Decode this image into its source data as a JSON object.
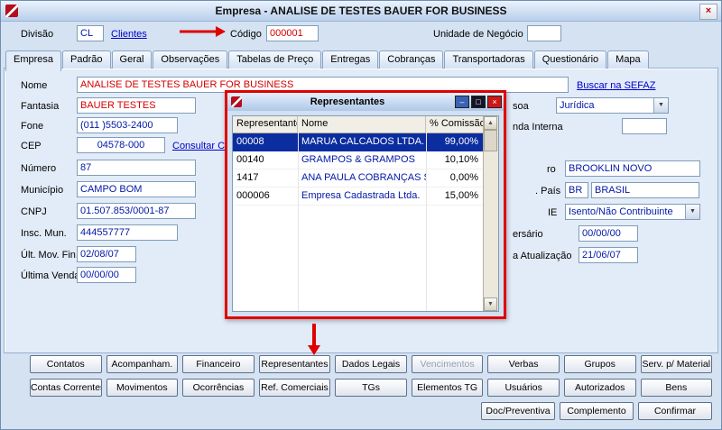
{
  "window": {
    "title": "Empresa - ANALISE DE TESTES BAUER FOR BUSINESS"
  },
  "glyphs": {
    "close": "×",
    "min": "–",
    "max": "□",
    "scroll_up": "▲",
    "scroll_down": "▼",
    "dropdown": "▼"
  },
  "header": {
    "divisao_label": "Divisão",
    "divisao_value": "CL",
    "clientes_link": "Clientes",
    "codigo_label": "Código",
    "codigo_value": "000001",
    "unidade_label": "Unidade de Negócio",
    "unidade_value": ""
  },
  "tabs": {
    "items": [
      "Empresa",
      "Padrão",
      "Geral",
      "Observações",
      "Tabelas de Preço",
      "Entregas",
      "Cobranças",
      "Transportadoras",
      "Questionário",
      "Mapa"
    ]
  },
  "form": {
    "nome_label": "Nome",
    "nome_value": "ANALISE DE TESTES BAUER FOR BUSINESS",
    "sefaz_link": "Buscar na SEFAZ",
    "fantasia_label": "Fantasia",
    "fantasia_value": "BAUER TESTES",
    "fone_label": "Fone",
    "fone_value": "(011 )5503-2400",
    "cep_label": "CEP",
    "cep_value": "04578-000",
    "cep_link": "Consultar CEP",
    "numero_label": "Número",
    "numero_value": "87",
    "municipio_label": "Município",
    "municipio_value": "CAMPO BOM",
    "cnpj_label": "CNPJ",
    "cnpj_value": "01.507.853/0001-87",
    "insc_label": "Insc. Mun.",
    "insc_value": "444557777",
    "ult_mov_label": "Últ. Mov. Fin.",
    "ult_mov_value": "02/08/07",
    "ultima_venda_label": "Última Venda",
    "ultima_venda_value": "00/00/00"
  },
  "right": {
    "pessoa_label": "soa",
    "pessoa_value": "Jurídica",
    "venda_interna_label": "nda Interna",
    "venda_interna_value": "",
    "bairro_label": "ro",
    "bairro_value": "BROOKLIN NOVO",
    "pais_label": ". País",
    "pais_code": "BR",
    "pais_value": "BRASIL",
    "ie_label": "IE",
    "ie_value": "Isento/Não Contribuinte",
    "aniversario_label": "ersário",
    "aniversario_value": "00/00/00",
    "atualizacao_label": "a Atualização",
    "atualizacao_value": "21/06/07"
  },
  "popup": {
    "title": "Representantes",
    "columns": [
      "Representante",
      "Nome",
      "% Comissão"
    ],
    "rows": [
      {
        "code": "00008",
        "name": "MARUA CALCADOS LTDA.",
        "commission": "99,00%"
      },
      {
        "code": "00140",
        "name": "GRAMPOS & GRAMPOS",
        "commission": "10,10%"
      },
      {
        "code": "1417",
        "name": "ANA PAULA COBRANÇAS S.A.-",
        "commission": "0,00%"
      },
      {
        "code": "000006",
        "name": "Empresa Cadastrada Ltda.",
        "commission": "15,00%"
      }
    ]
  },
  "buttons": {
    "row1": [
      "Contatos",
      "Acompanham.",
      "Financeiro",
      "Representantes",
      "Dados Legais",
      "Vencimentos",
      "Verbas",
      "Grupos",
      "Serv. p/ Material"
    ],
    "row2": [
      "Contas Correntes",
      "Movimentos",
      "Ocorrências",
      "Ref. Comerciais",
      "TGs",
      "Elementos TG",
      "Usuários",
      "Autorizados",
      "Bens"
    ],
    "row3": [
      "Doc/Preventiva",
      "Complemento",
      "Confirmar"
    ]
  },
  "colors": {
    "accent_red": "#e00000",
    "link_blue": "#0000c8",
    "value_red": "#d40000",
    "value_blue": "#0018a8",
    "selection_blue": "#0b2da0"
  }
}
